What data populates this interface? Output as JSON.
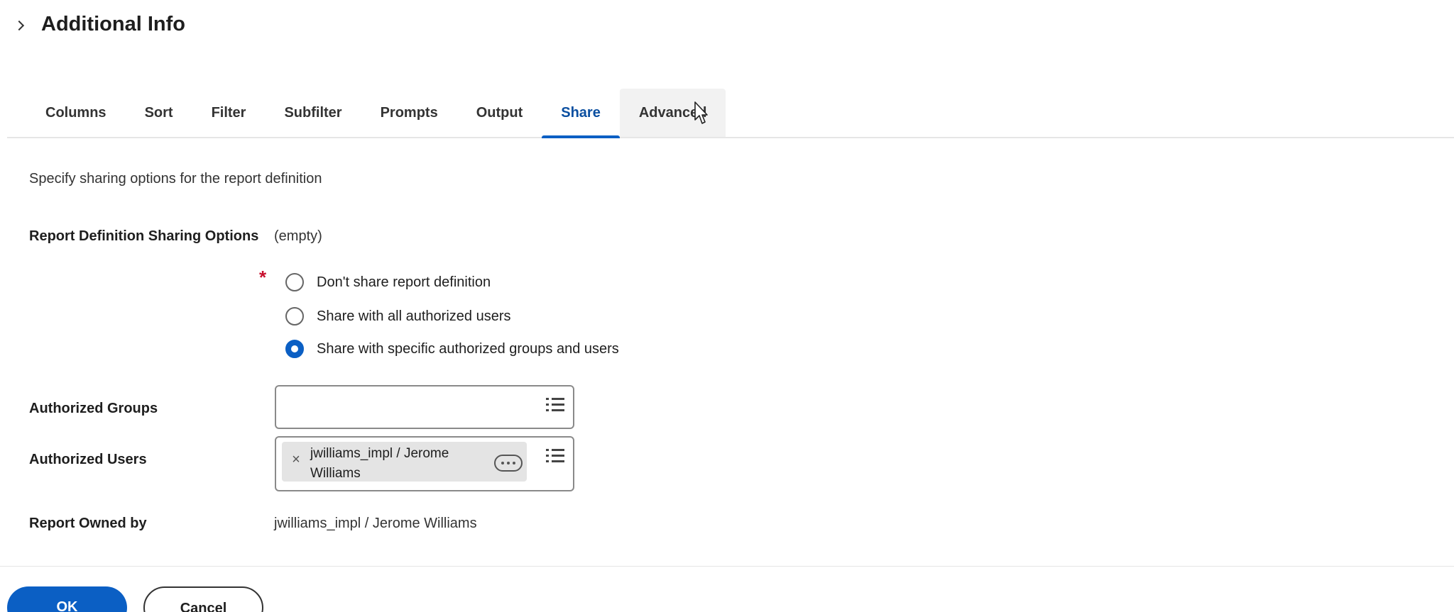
{
  "header": {
    "title": "Additional Info"
  },
  "tabs": [
    {
      "label": "Columns"
    },
    {
      "label": "Sort"
    },
    {
      "label": "Filter"
    },
    {
      "label": "Subfilter"
    },
    {
      "label": "Prompts"
    },
    {
      "label": "Output"
    },
    {
      "label": "Share"
    },
    {
      "label": "Advanced"
    }
  ],
  "active_tab": "Share",
  "share": {
    "instructions": "Specify sharing options for the report definition",
    "sharing_options_label": "Report Definition Sharing Options",
    "sharing_options_value": "(empty)",
    "required_marker": "*",
    "radio_options": [
      {
        "label": "Don't share report definition",
        "selected": false
      },
      {
        "label": "Share with all authorized users",
        "selected": false
      },
      {
        "label": "Share with specific authorized groups and users",
        "selected": true
      }
    ],
    "authorized_groups_label": "Authorized Groups",
    "authorized_groups_value": "",
    "authorized_users_label": "Authorized Users",
    "authorized_users_pill": "jwilliams_impl / Jerome Williams",
    "pill_remove_glyph": "×",
    "owned_by_label": "Report Owned by",
    "owned_by_value": "jwilliams_impl / Jerome Williams"
  },
  "buttons": {
    "ok": "OK",
    "cancel": "Cancel"
  },
  "colors": {
    "accent": "#0b5fc4",
    "required": "#c8102e",
    "pill_bg": "#e4e4e4"
  },
  "icons": [
    "chevron-right-icon",
    "list-icon",
    "close-icon",
    "more-icon",
    "cursor-icon"
  ]
}
